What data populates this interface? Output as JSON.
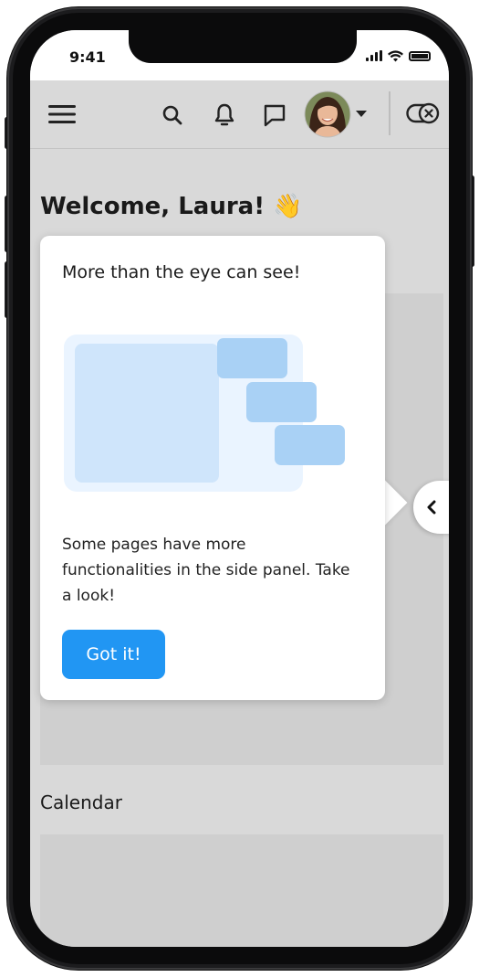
{
  "status": {
    "time": "9:41"
  },
  "header": {
    "icons": [
      "menu-icon",
      "search-icon",
      "bell-icon",
      "chat-icon",
      "avatar",
      "chevron-down-icon",
      "toggle-icon"
    ]
  },
  "welcome": {
    "text": "Welcome, Laura! 👋"
  },
  "popover": {
    "title": "More than the eye can see!",
    "body": "Some pages have more functionalities in the side panel. Take a look!",
    "button_label": "Got it!"
  },
  "section": {
    "calendar_title": "Calendar"
  },
  "colors": {
    "accent": "#2196f3",
    "illustration_light": "#eaf4ff",
    "illustration_mid": "#cfe5fb",
    "illustration_dark": "#a9d1f5"
  }
}
